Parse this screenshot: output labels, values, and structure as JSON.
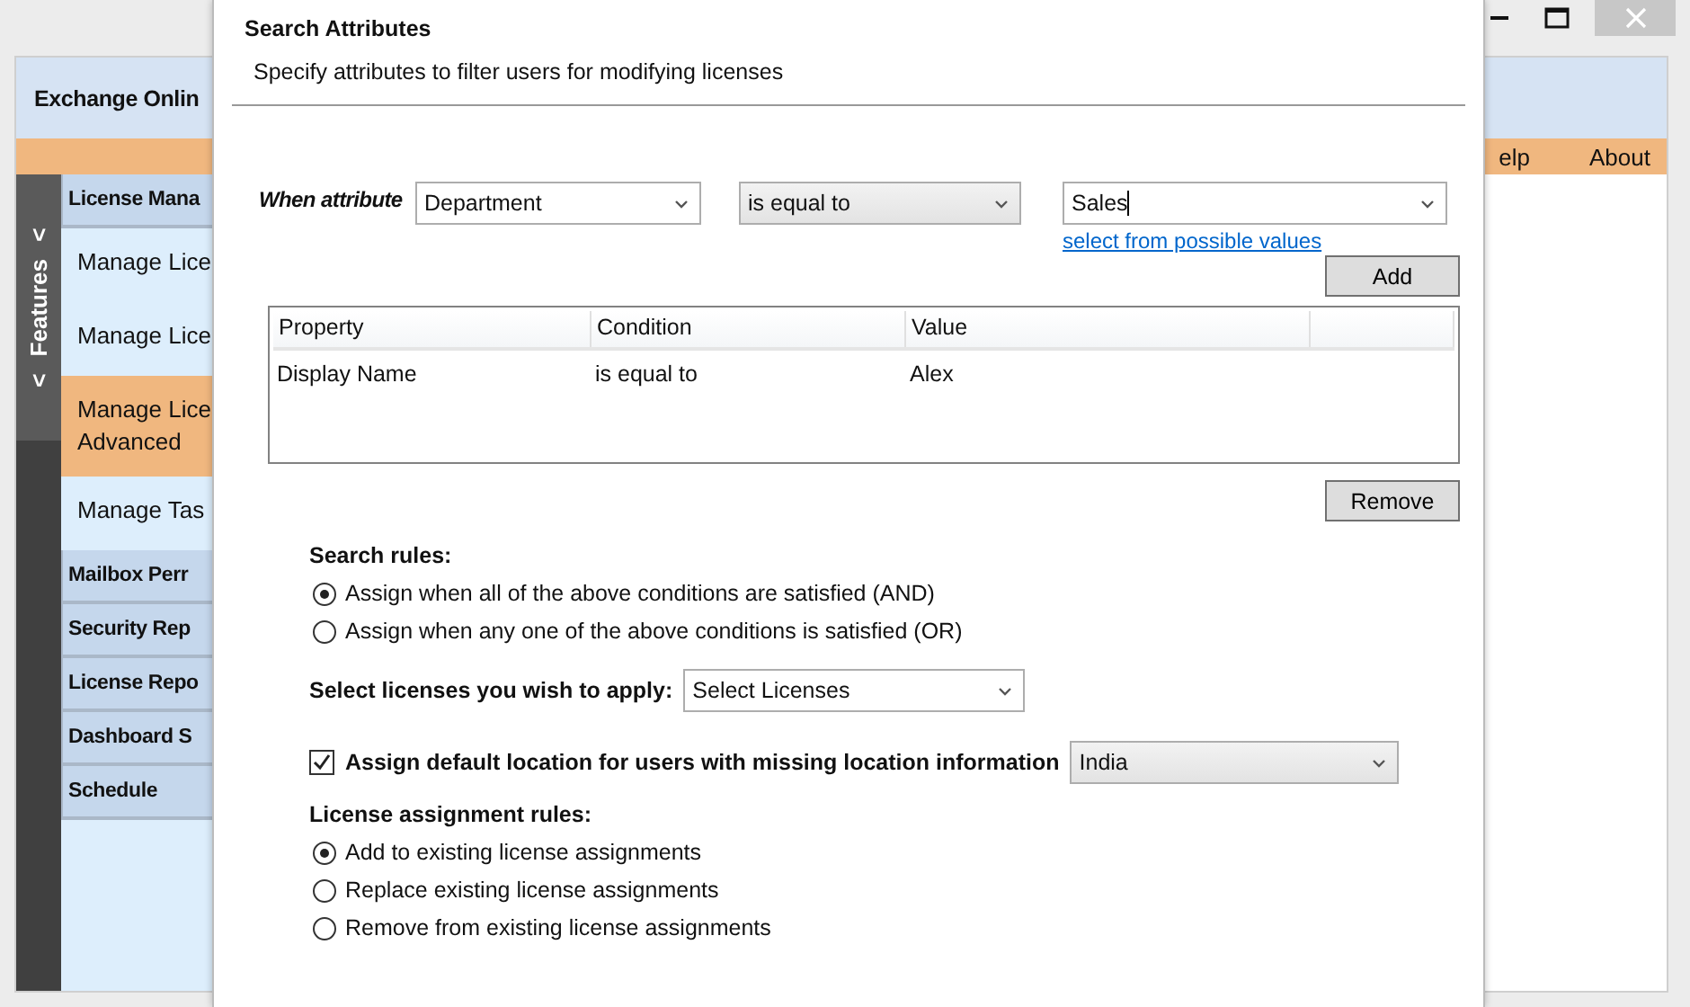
{
  "app": {
    "title": "Exchange Onlin",
    "menu": [
      {
        "label": "elp"
      },
      {
        "label": "About"
      }
    ],
    "side_tab": {
      "label": "Features",
      "chevrons": [
        ">",
        ">"
      ]
    },
    "nav": [
      {
        "kind": "group",
        "label": "License Mana"
      },
      {
        "kind": "item",
        "label": "Manage Lice",
        "selected": false
      },
      {
        "kind": "item",
        "label": "Manage Lice",
        "selected": false
      },
      {
        "kind": "item",
        "label": "Manage Lice\nAdvanced",
        "selected": true
      },
      {
        "kind": "item",
        "label": "Manage Tas",
        "selected": false
      },
      {
        "kind": "group",
        "label": "Mailbox Perr"
      },
      {
        "kind": "group",
        "label": "Security Rep"
      },
      {
        "kind": "group",
        "label": "License Repo"
      },
      {
        "kind": "group",
        "label": "Dashboard S"
      },
      {
        "kind": "group",
        "label": "Schedule"
      }
    ]
  },
  "dialog": {
    "title": "Search Attributes",
    "subtitle": "Specify attributes to filter users for modifying licenses",
    "condition": {
      "label": "When attribute",
      "attribute": "Department",
      "operator": "is equal to",
      "value": "Sales",
      "link": "select from possible values"
    },
    "add_button": "Add",
    "table": {
      "columns": [
        "Property",
        "Condition",
        "Value"
      ],
      "rows": [
        [
          "Display Name",
          "is equal to",
          "Alex"
        ]
      ]
    },
    "remove_button": "Remove",
    "search_rules": {
      "label": "Search rules:",
      "options": [
        {
          "label": "Assign when all of the above conditions are satisfied (AND)",
          "selected": true
        },
        {
          "label": "Assign when any one of the above conditions is satisfied (OR)",
          "selected": false
        }
      ]
    },
    "licenses": {
      "label": "Select licenses you wish to apply:",
      "value": "Select Licenses"
    },
    "default_location": {
      "label": "Assign default location for users with missing location information",
      "checked": true,
      "value": "India"
    },
    "assignment_rules": {
      "label": "License assignment rules:",
      "options": [
        {
          "label": "Add to existing license assignments",
          "selected": true
        },
        {
          "label": "Replace existing license assignments",
          "selected": false
        },
        {
          "label": "Remove from existing license assignments",
          "selected": false
        }
      ]
    }
  }
}
